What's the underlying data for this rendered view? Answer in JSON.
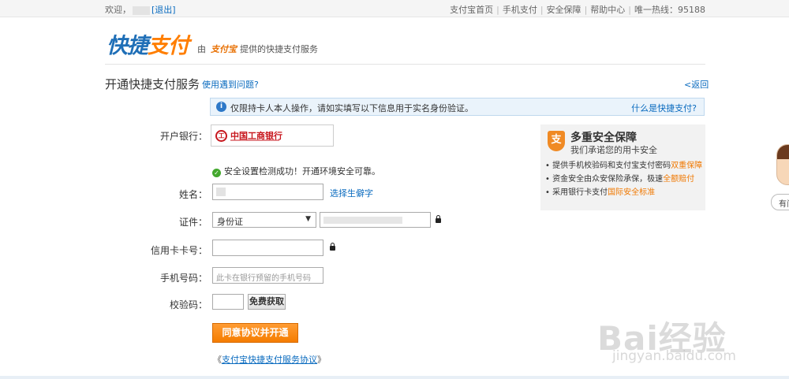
{
  "topbar": {
    "welcome": "欢迎，",
    "logout": "[退出]",
    "links": [
      "支付宝首页",
      "手机支付",
      "安全保障",
      "帮助中心",
      "唯一热线：95188"
    ]
  },
  "header": {
    "logo_part1": "快捷",
    "logo_part2": "支付",
    "by": "由",
    "brand": "支付宝",
    "byline": "提供的快捷支付服务"
  },
  "page": {
    "title": "开通快捷支付服务",
    "help_link": "使用遇到问题?",
    "back_link": "<返回"
  },
  "notice": {
    "text": "仅限持卡人本人操作，请如实填写以下信息用于实名身份验证。",
    "link": "什么是快捷支付?"
  },
  "form": {
    "bank_label": "开户银行：",
    "bank_name": "中国工商银行",
    "check_ok": "安全设置检测成功！开通环境安全可靠。",
    "name_label": "姓名：",
    "rare_char_link": "选择生僻字",
    "id_label": "证件：",
    "id_type": "身份证",
    "card_label": "信用卡卡号：",
    "phone_label": "手机号码：",
    "phone_placeholder": "此卡在银行预留的手机号码",
    "code_label": "校验码：",
    "get_code_btn": "免费获取",
    "submit_btn": "同意协议并开通",
    "agreement_prefix": "《",
    "agreement_link": "支付宝快捷支付服务协议",
    "agreement_suffix": "》"
  },
  "security": {
    "title": "多重安全保障",
    "subtitle": "我们承诺您的用卡安全",
    "items": [
      {
        "text": "提供手机校验码和支付宝支付密码",
        "highlight": "双重保障"
      },
      {
        "text": "资金安全由众安保险承保，极速",
        "highlight": "全额赔付"
      },
      {
        "text": "采用银行卡支付",
        "highlight": "国际安全标准"
      }
    ]
  },
  "side": {
    "bubble": "有问"
  },
  "watermark": {
    "main": "Bai经验",
    "url": "jingyan.baidu.com"
  },
  "colors": {
    "link": "#0a6bbf",
    "accent": "#f57d00",
    "bank_red": "#c7161d",
    "success": "#44a82e"
  }
}
